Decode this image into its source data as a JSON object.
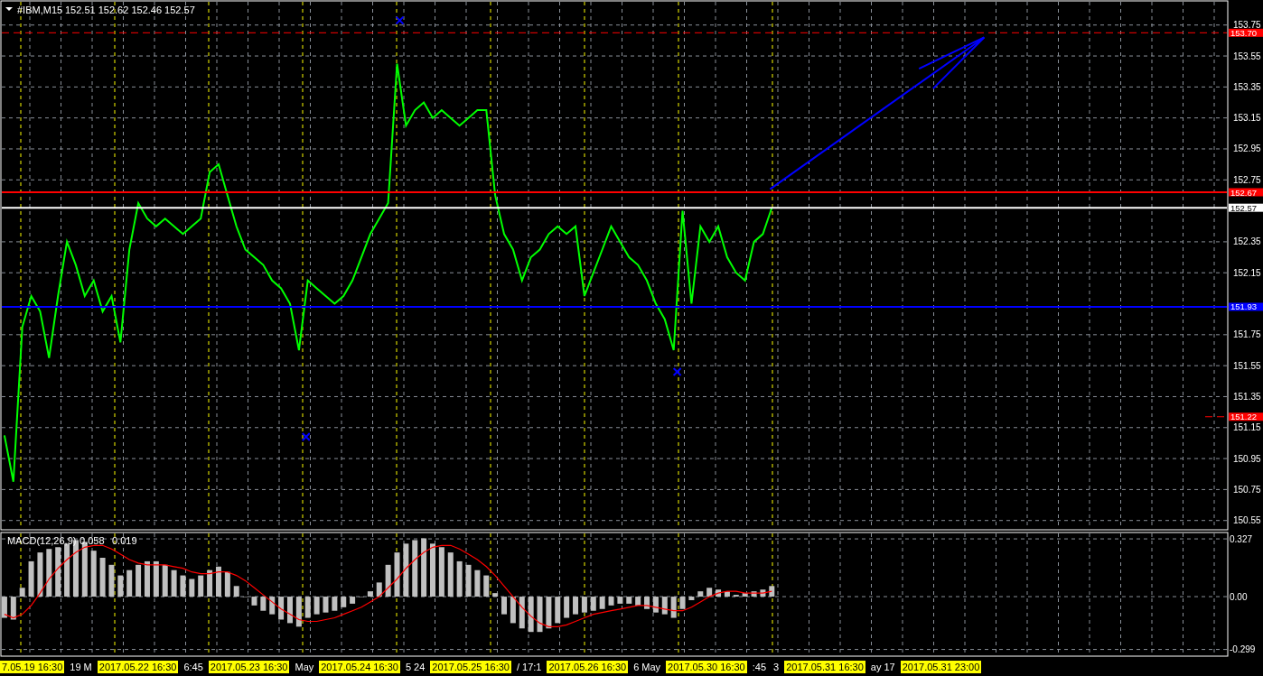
{
  "header": {
    "symbol": "#IBM,M15",
    "ohlc": "152.51 152.62 152.46 152.57"
  },
  "price_chart": {
    "chart_data": {
      "type": "line",
      "grid": true,
      "ylim": [
        150.49,
        153.9
      ],
      "yticks": [
        150.55,
        150.75,
        150.95,
        151.15,
        151.35,
        151.55,
        151.75,
        152.15,
        152.35,
        152.75,
        152.95,
        153.15,
        153.35,
        153.55,
        153.75
      ],
      "series": [
        {
          "color": "#00ff00",
          "values": [
            151.1,
            150.8,
            151.8,
            152.0,
            151.9,
            151.6,
            152.0,
            152.35,
            152.2,
            152.0,
            152.1,
            151.9,
            152.0,
            151.7,
            152.3,
            152.6,
            152.5,
            152.45,
            152.5,
            152.45,
            152.4,
            152.45,
            152.5,
            152.8,
            152.85,
            152.65,
            152.45,
            152.3,
            152.25,
            152.2,
            152.1,
            152.05,
            151.95,
            151.65,
            152.1,
            152.05,
            152.0,
            151.95,
            152.0,
            152.1,
            152.25,
            152.4,
            152.5,
            152.6,
            153.5,
            153.1,
            153.2,
            153.25,
            153.15,
            153.2,
            153.15,
            153.1,
            153.15,
            153.2,
            153.2,
            152.65,
            152.4,
            152.3,
            152.1,
            152.25,
            152.3,
            152.4,
            152.45,
            152.4,
            152.45,
            152.0,
            152.15,
            152.3,
            152.45,
            152.35,
            152.25,
            152.2,
            152.1,
            151.95,
            151.85,
            151.65,
            152.55,
            151.95,
            152.45,
            152.35,
            152.45,
            152.25,
            152.15,
            152.1,
            152.35,
            152.4,
            152.57
          ]
        }
      ],
      "ref_lines": [
        {
          "axis": "y",
          "value": 153.7,
          "label": "153.70",
          "color": "#ff0000"
        },
        {
          "axis": "y",
          "value": 152.67,
          "label": "152.67",
          "color": "#ff0000"
        },
        {
          "axis": "y",
          "value": 152.57,
          "label": "152.57",
          "color": "#ffffff"
        },
        {
          "axis": "y",
          "value": 151.93,
          "label": "151.93",
          "color": "#0000ff"
        },
        {
          "axis": "y",
          "value": 151.22,
          "label": "151.22",
          "color": "#ff0000"
        }
      ]
    },
    "markers": [
      {
        "kind": "arrow",
        "color": "#0000ff"
      },
      {
        "kind": "cross",
        "color": "#0000ff"
      },
      {
        "kind": "cross",
        "color": "#0000ff"
      },
      {
        "kind": "cross",
        "color": "#0000ff"
      }
    ]
  },
  "indicator": {
    "values": [
      "0.058",
      "0.019"
    ],
    "chart_data": {
      "type": "bar",
      "grid": true,
      "ylim": [
        -0.337,
        0.358
      ],
      "yticks": [
        {
          "value": 0.327,
          "label": "0.327"
        },
        {
          "value": 0,
          "label": "0.00"
        },
        {
          "value": -0.299,
          "label": "-0.299"
        }
      ],
      "series": [
        {
          "name": "MACD(12,26,9)",
          "color": "#c0c0c0",
          "values": [
            -0.12,
            -0.13,
            0.05,
            0.2,
            0.25,
            0.27,
            0.28,
            0.3,
            0.32,
            0.31,
            0.26,
            0.22,
            0.18,
            0.12,
            0.15,
            0.18,
            0.2,
            0.2,
            0.18,
            0.15,
            0.12,
            0.1,
            0.12,
            0.15,
            0.17,
            0.14,
            0.06,
            0.0,
            -0.05,
            -0.08,
            -0.1,
            -0.13,
            -0.15,
            -0.17,
            -0.12,
            -0.1,
            -0.09,
            -0.08,
            -0.06,
            -0.04,
            0.0,
            0.03,
            0.08,
            0.18,
            0.25,
            0.3,
            0.32,
            0.33,
            0.3,
            0.28,
            0.25,
            0.2,
            0.18,
            0.15,
            0.12,
            0.02,
            -0.1,
            -0.15,
            -0.18,
            -0.2,
            -0.2,
            -0.18,
            -0.15,
            -0.12,
            -0.1,
            -0.09,
            -0.08,
            -0.07,
            -0.05,
            -0.04,
            -0.04,
            -0.05,
            -0.07,
            -0.09,
            -0.1,
            -0.12,
            -0.07,
            -0.02,
            0.03,
            0.05,
            0.04,
            0.03,
            0.01,
            0.02,
            0.03,
            0.04,
            0.06
          ]
        },
        {
          "type": "line",
          "color": "#ff0000",
          "values": [
            -0.1,
            -0.12,
            -0.1,
            -0.05,
            0.02,
            0.1,
            0.16,
            0.21,
            0.25,
            0.28,
            0.29,
            0.29,
            0.27,
            0.24,
            0.21,
            0.19,
            0.18,
            0.18,
            0.18,
            0.17,
            0.16,
            0.14,
            0.13,
            0.13,
            0.14,
            0.14,
            0.12,
            0.09,
            0.05,
            0.01,
            -0.03,
            -0.07,
            -0.1,
            -0.13,
            -0.14,
            -0.14,
            -0.13,
            -0.12,
            -0.1,
            -0.08,
            -0.06,
            -0.03,
            0.0,
            0.05,
            0.1,
            0.16,
            0.21,
            0.25,
            0.28,
            0.29,
            0.29,
            0.27,
            0.24,
            0.21,
            0.17,
            0.12,
            0.06,
            0.0,
            -0.06,
            -0.11,
            -0.15,
            -0.17,
            -0.17,
            -0.16,
            -0.14,
            -0.12,
            -0.1,
            -0.09,
            -0.08,
            -0.07,
            -0.06,
            -0.05,
            -0.05,
            -0.06,
            -0.07,
            -0.08,
            -0.08,
            -0.06,
            -0.03,
            0.0,
            0.02,
            0.03,
            0.03,
            0.02,
            0.02,
            0.02,
            0.03
          ]
        }
      ]
    }
  },
  "time_axis": [
    {
      "text": "7.05.19 16:30",
      "highlighted": true
    },
    {
      "text": "19 M",
      "highlighted": false
    },
    {
      "text": "2017.05.22 16:30",
      "highlighted": true
    },
    {
      "text": "6:45",
      "highlighted": false
    },
    {
      "text": "2017.05.23 16:30",
      "highlighted": true
    },
    {
      "text": "May",
      "highlighted": false
    },
    {
      "text": "2017.05.24 16:30",
      "highlighted": true
    },
    {
      "text": "5 24",
      "highlighted": false
    },
    {
      "text": "2017.05.25 16:30",
      "highlighted": true
    },
    {
      "text": "/ 17:1",
      "highlighted": false
    },
    {
      "text": "2017.05.26 16:30",
      "highlighted": true
    },
    {
      "text": "6 May",
      "highlighted": false
    },
    {
      "text": "2017.05.30 16:30",
      "highlighted": true
    },
    {
      "text": ":45",
      "highlighted": false
    },
    {
      "text": "3",
      "highlighted": false
    },
    {
      "text": "2017.05.31 16:30",
      "highlighted": true
    },
    {
      "text": "ay 17",
      "highlighted": false
    },
    {
      "text": "2017.05.31 23:00",
      "highlighted": true
    }
  ]
}
